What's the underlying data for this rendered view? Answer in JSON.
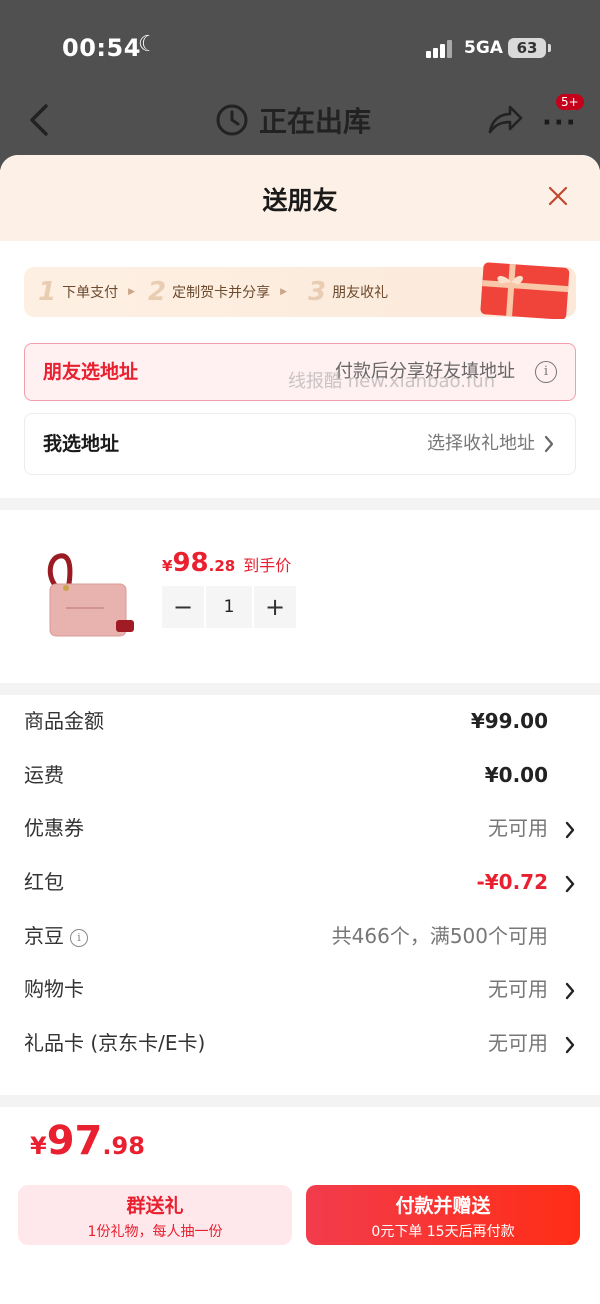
{
  "status": {
    "time": "00:54",
    "network": "5GA",
    "battery": "63"
  },
  "nav": {
    "title": "正在出库",
    "badge": "5+",
    "more": "···"
  },
  "sheet": {
    "title": "送朋友",
    "steps": [
      {
        "num": "1",
        "label": "下单支付"
      },
      {
        "num": "2",
        "label": "定制贺卡并分享"
      },
      {
        "num": "3",
        "label": "朋友收礼"
      }
    ]
  },
  "address": {
    "friend": {
      "label": "朋友选地址",
      "hint": "付款后分享好友填地址"
    },
    "mine": {
      "label": "我选地址",
      "hint": "选择收礼地址"
    },
    "watermark": "线报酷 new.xianbao.fun"
  },
  "product": {
    "currency": "¥",
    "price_int": "98",
    "price_dec": ".28",
    "price_tag": "到手价",
    "quantity": "1",
    "minus": "−",
    "plus": "+"
  },
  "fees": [
    {
      "key": "商品金额",
      "value": "¥99.00",
      "style": "bold",
      "chevron": false
    },
    {
      "key": "运费",
      "value": "¥0.00",
      "style": "bold",
      "chevron": false
    },
    {
      "key": "优惠券",
      "value": "无可用",
      "style": "dim",
      "chevron": true
    },
    {
      "key": "红包",
      "value": "-¥0.72",
      "style": "red",
      "chevron": true
    },
    {
      "key": "京豆",
      "value": "共466个，满500个可用",
      "style": "dim",
      "chevron": false,
      "info": true
    },
    {
      "key": "购物卡",
      "value": "无可用",
      "style": "dim",
      "chevron": true
    },
    {
      "key": "礼品卡 (京东卡/E卡)",
      "value": "无可用",
      "style": "dim",
      "chevron": true
    }
  ],
  "total": {
    "currency": "¥",
    "int": "97",
    "dec": ".98"
  },
  "buttons": {
    "group": {
      "main": "群送礼",
      "sub": "1份礼物，每人抽一份"
    },
    "pay": {
      "main": "付款并赠送",
      "sub": "0元下单 15天后再付款"
    }
  },
  "colors": {
    "accent": "#e8202f",
    "sheet_header": "#fdf1e7",
    "overlay": "#505050"
  }
}
